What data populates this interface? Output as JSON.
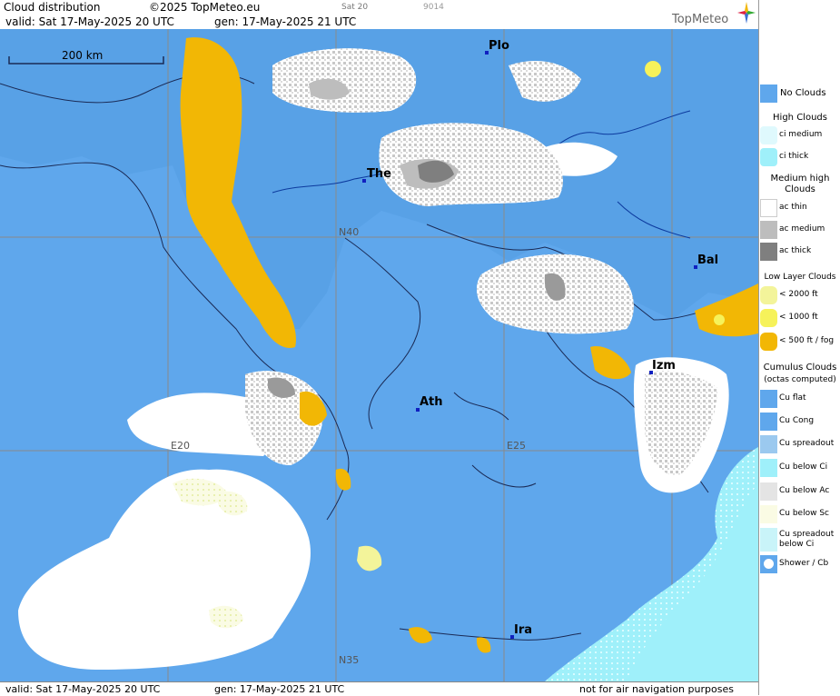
{
  "header": {
    "product": "Cloud distribution",
    "copyright": "©2025 TopMeteo.eu",
    "valid_text": "valid:  Sat  17-May-2025  20 UTC",
    "gen_text": "gen: 17-May-2025 21 UTC",
    "tab_day": "Sat 20",
    "tab_id": "9014",
    "logo_text": "TopMeteo"
  },
  "map": {
    "scale_label": "200 km",
    "grid_labels": {
      "n40": "N40",
      "n35": "N35",
      "e20": "E20",
      "e25": "E25"
    },
    "cities": [
      {
        "name": "Plo"
      },
      {
        "name": "The"
      },
      {
        "name": "Bal"
      },
      {
        "name": "Izm"
      },
      {
        "name": "Ath"
      },
      {
        "name": "Ira"
      }
    ],
    "colors": {
      "sea": "#5fa7ec",
      "land": "#5aa3e8",
      "gridline": "#8a8a8a",
      "coast": "#1a2a55",
      "river": "#0c3a9e",
      "low_cloud": "#f2b705",
      "ac_medium": "#bdbdbd",
      "ac_thick": "#7f7f7f",
      "ci_thick": "#9ff0fa",
      "cumulus": "#ffffff"
    }
  },
  "footer": {
    "valid_text": "valid:  Sat  17-May-2025  20 UTC",
    "gen_text": "gen: 17-May-2025 21 UTC",
    "disclaimer": "not for air navigation purposes"
  },
  "legend": {
    "no_clouds": "No Clouds",
    "high_title": "High Clouds",
    "ci_medium": "ci medium",
    "ci_thick": "ci thick",
    "medium_title": "Medium high Clouds",
    "ac_thin": "ac thin",
    "ac_medium": "ac medium",
    "ac_thick": "ac thick",
    "low_title": "Low Layer Clouds",
    "low_2000": "< 2000 ft",
    "low_1000": "< 1000 ft",
    "low_500": "< 500 ft / fog",
    "cu_title": "Cumulus Clouds",
    "cu_subtitle": "(octas computed)",
    "cu_flat": "Cu flat",
    "cu_cong": "Cu Cong",
    "cu_spreadout": "Cu spreadout",
    "cu_below_ci": "Cu below Ci",
    "cu_below_ac": "Cu below Ac",
    "cu_below_sc": "Cu below Sc",
    "cu_spreadout_below_ci": "Cu spreadout below Ci",
    "shower": "Shower / Cb"
  }
}
